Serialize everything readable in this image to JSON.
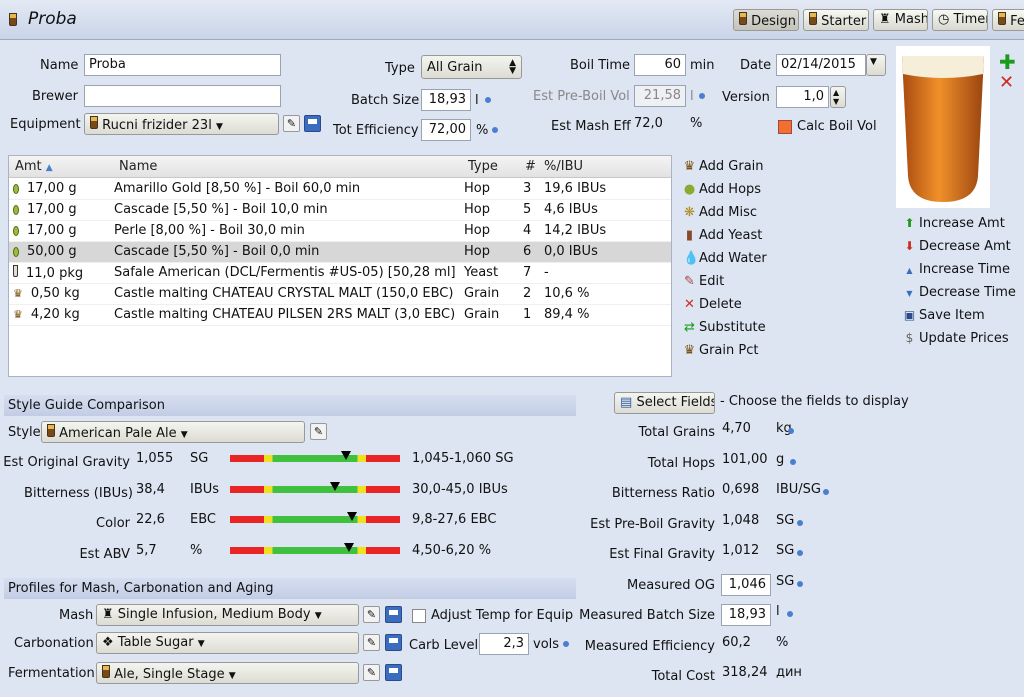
{
  "header": {
    "title": "Proba",
    "tabs": [
      {
        "label": "Design"
      },
      {
        "label": "Starter"
      },
      {
        "label": "Mash"
      },
      {
        "label": "Timer"
      },
      {
        "label": "Fe"
      }
    ]
  },
  "form": {
    "name_label": "Name",
    "name_value": "Proba",
    "brewer_label": "Brewer",
    "brewer_value": "",
    "equipment_label": "Equipment",
    "equipment_value": "Rucni frizider 23l",
    "type_label": "Type",
    "type_value": "All Grain",
    "batch_label": "Batch Size",
    "batch_value": "18,93",
    "batch_unit": "l",
    "eff_label": "Tot Efficiency",
    "eff_value": "72,00",
    "eff_unit": "%",
    "boil_label": "Boil Time",
    "boil_value": "60",
    "boil_unit": "min",
    "preboil_label": "Est Pre-Boil Vol",
    "preboil_value": "21,58",
    "preboil_unit": "l",
    "mash_eff_label": "Est Mash Eff",
    "mash_eff_value": "72,0",
    "mash_eff_unit": "%",
    "date_label": "Date",
    "date_value": "02/14/2015",
    "version_label": "Version",
    "version_value": "1,0",
    "calc_boil_label": "Calc Boil Vol"
  },
  "ingredients": {
    "columns": [
      "Amt",
      "Name",
      "Type",
      "#",
      "%/IBU"
    ],
    "rows": [
      {
        "icon": "hop",
        "amt": "17,00 g",
        "name": "Amarillo Gold [8,50 %] - Boil 60,0 min",
        "type": "Hop",
        "num": "3",
        "pct": "19,6 IBUs"
      },
      {
        "icon": "hop",
        "amt": "17,00 g",
        "name": "Cascade [5,50 %] - Boil 10,0 min",
        "type": "Hop",
        "num": "5",
        "pct": "4,6 IBUs"
      },
      {
        "icon": "hop",
        "amt": "17,00 g",
        "name": "Perle [8,00 %] - Boil 30,0 min",
        "type": "Hop",
        "num": "4",
        "pct": "14,2 IBUs"
      },
      {
        "icon": "hop",
        "amt": "50,00 g",
        "name": "Cascade [5,50 %] - Boil 0,0 min",
        "type": "Hop",
        "num": "6",
        "pct": "0,0 IBUs",
        "selected": true
      },
      {
        "icon": "yeast",
        "amt": "11,0 pkg",
        "name": "Safale American  (DCL/Fermentis #US-05) [50,28 ml]",
        "type": "Yeast",
        "num": "7",
        "pct": "-"
      },
      {
        "icon": "grain",
        "amt": "0,50 kg",
        "name": "Castle malting CHÂTEAU CRYSTAL MALT (150,0 EBC)",
        "type": "Grain",
        "num": "2",
        "pct": "10,6 %"
      },
      {
        "icon": "grain",
        "amt": "4,20 kg",
        "name": "Castle malting CHÂTEAU PILSEN 2RS MALT (3,0 EBC)",
        "type": "Grain",
        "num": "1",
        "pct": "89,4 %"
      }
    ]
  },
  "actions": [
    "Add Grain",
    "Add Hops",
    "Add Misc",
    "Add Yeast",
    "Add Water",
    "Edit",
    "Delete",
    "Substitute",
    "Grain Pct"
  ],
  "side_actions": [
    "Increase Amt",
    "Decrease Amt",
    "Increase Time",
    "Decrease Time",
    "Save Item",
    "Update Prices"
  ],
  "style": {
    "section": "Style Guide Comparison",
    "style_label": "Style",
    "style_value": "American Pale Ale",
    "rows": [
      {
        "label": "Est Original Gravity",
        "value": "1,055",
        "unit": "SG",
        "range": "1,045-1,060 SG",
        "marker": 0.68
      },
      {
        "label": "Bitterness (IBUs)",
        "value": "38,4",
        "unit": "IBUs",
        "range": "30,0-45,0 IBUs",
        "marker": 0.62
      },
      {
        "label": "Color",
        "value": "22,6",
        "unit": "EBC",
        "range": "9,8-27,6 EBC",
        "marker": 0.72
      },
      {
        "label": "Est ABV",
        "value": "5,7",
        "unit": "%",
        "range": "4,50-6,20 %",
        "marker": 0.7
      }
    ]
  },
  "profiles": {
    "section": "Profiles for Mash, Carbonation and Aging",
    "mash_label": "Mash",
    "mash_value": "Single Infusion, Medium Body",
    "adjust_label": "Adjust Temp for Equip",
    "carb_label": "Carbonation",
    "carb_value": "Table Sugar",
    "carb_level_label": "Carb Level",
    "carb_level_value": "2,3",
    "carb_level_unit": "vols",
    "ferm_label": "Fermentation",
    "ferm_value": "Ale, Single Stage"
  },
  "fields": {
    "button": "Select Fields",
    "hint": "- Choose the fields to display",
    "rows": [
      {
        "label": "Total Grains",
        "value": "4,70",
        "unit": "kg"
      },
      {
        "label": "Total Hops",
        "value": "101,00",
        "unit": "g"
      },
      {
        "label": "Bitterness Ratio",
        "value": "0,698",
        "unit": "IBU/SG"
      },
      {
        "label": "Est Pre-Boil Gravity",
        "value": "1,048",
        "unit": "SG"
      },
      {
        "label": "Est Final Gravity",
        "value": "1,012",
        "unit": "SG"
      },
      {
        "label": "Measured OG",
        "value": "1,046",
        "unit": "SG",
        "input": true
      },
      {
        "label": "Measured Batch Size",
        "value": "18,93",
        "unit": "l",
        "input": true
      },
      {
        "label": "Measured Efficiency",
        "value": "60,2",
        "unit": "%"
      },
      {
        "label": "Total Cost",
        "value": "318,24",
        "unit": "дин"
      }
    ]
  }
}
